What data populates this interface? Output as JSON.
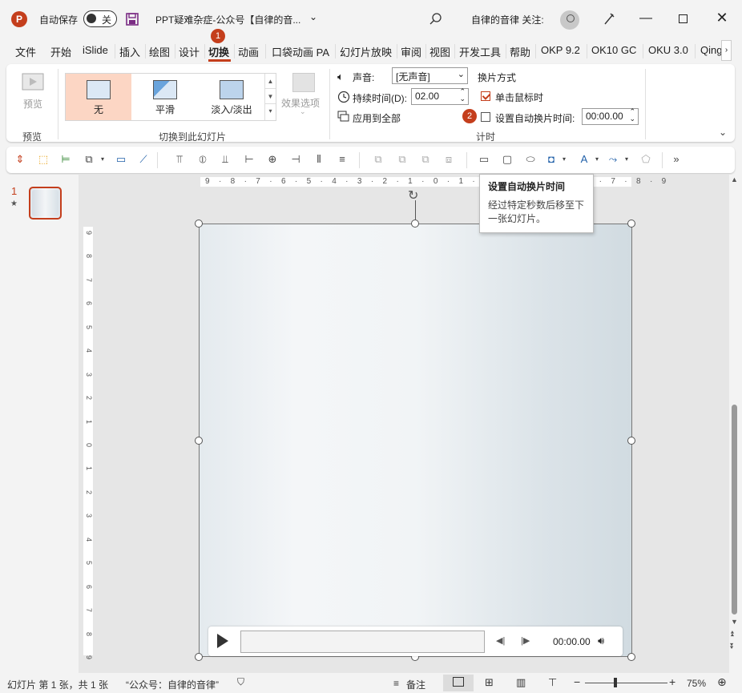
{
  "titlebar": {
    "app_logo": "P",
    "autosave_label": "自动保存",
    "autosave_state": "关",
    "doc_title": "PPT疑难杂症-公众号【自律的音...",
    "account_text": "自律的音律 关注:",
    "icons": [
      "save-icon",
      "search-icon",
      "pen-icon",
      "minimize-icon",
      "maximize-icon",
      "close-icon"
    ]
  },
  "tabs": [
    {
      "label": "文件"
    },
    {
      "label": "开始"
    },
    {
      "label": "iSlide"
    },
    {
      "label": "插入"
    },
    {
      "label": "绘图"
    },
    {
      "label": "设计"
    },
    {
      "label": "切换"
    },
    {
      "label": "动画"
    },
    {
      "label": "口袋动画 PA"
    },
    {
      "label": "幻灯片放映"
    },
    {
      "label": "审阅"
    },
    {
      "label": "视图"
    },
    {
      "label": "开发工具"
    },
    {
      "label": "帮助"
    },
    {
      "label": "OKP 9.2"
    },
    {
      "label": "OK10 GC"
    },
    {
      "label": "OKU 3.0"
    },
    {
      "label": "Qing"
    }
  ],
  "badges": {
    "one": "1",
    "two": "2"
  },
  "ribbon": {
    "preview_btn": "预览",
    "preview_group": "预览",
    "transitions": [
      {
        "label": "无"
      },
      {
        "label": "平滑"
      },
      {
        "label": "淡入/淡出"
      }
    ],
    "effect_options": "效果选项",
    "transition_group": "切换到此幻灯片",
    "sound_label": "声音:",
    "sound_value": "[无声音]",
    "duration_label": "持续时间(D):",
    "duration_value": "02.00",
    "apply_all": "应用到全部",
    "advance_title": "换片方式",
    "on_click_label": "单击鼠标时",
    "on_click_checked": true,
    "auto_label": "设置自动换片时间:",
    "auto_checked": false,
    "auto_value": "00:00.00",
    "timing_group": "计时"
  },
  "tooltip": {
    "title": "设置自动换片时间",
    "body": "经过特定秒数后移至下一张幻灯片。"
  },
  "slides_pane": {
    "slide_number": "1",
    "star": "★"
  },
  "ruler": {
    "h_labels": "9 · 8 · 7 · 6 · 5 · 4 · 3 · 2 · 1 · 0 · 1 · 2 · 3 · 4 · 5 · 6 · 7 · 8 · 9",
    "v_labels": [
      "9",
      "8",
      "7",
      "6",
      "5",
      "4",
      "3",
      "2",
      "1",
      "0",
      "1",
      "2",
      "3",
      "4",
      "5",
      "6",
      "7",
      "8",
      "9"
    ]
  },
  "media": {
    "time": "00:00.00"
  },
  "statusbar": {
    "slide_info": "幻灯片 第 1 张，共 1 张",
    "theme": "“公众号：自律的音律”",
    "notes": "备注",
    "zoom_minus": "−",
    "zoom_plus": "+",
    "zoom": "75%"
  },
  "colors": {
    "accent": "#c43e1c",
    "selected": "#fcd6c4"
  }
}
